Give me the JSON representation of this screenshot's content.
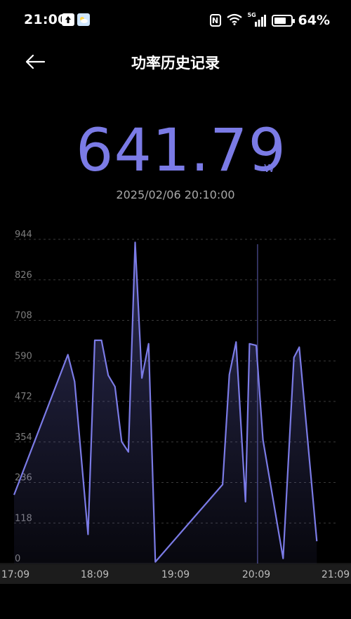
{
  "status_bar": {
    "time": "21:00",
    "battery": "64%",
    "signal_label": "5G",
    "nfc_label": "N"
  },
  "header": {
    "title": "功率历史记录",
    "back_icon": "arrow-left-icon"
  },
  "reading": {
    "value": "641.79",
    "unit": "W",
    "timestamp": "2025/02/06 20:10:00"
  },
  "colors": {
    "background": "#000000",
    "accent": "#7b7be6",
    "grid": "#3a3a3a",
    "axis_text": "#7d7d7d"
  },
  "chart_data": {
    "type": "area",
    "title": "",
    "xlabel": "",
    "ylabel": "",
    "y_ticks": [
      "944",
      "826",
      "708",
      "590",
      "472",
      "354",
      "236",
      "118",
      "0"
    ],
    "x_ticks": [
      "17:09",
      "18:09",
      "19:09",
      "20:09",
      "21:09"
    ],
    "ylim": [
      0,
      944
    ],
    "xlim_minutes": [
      0,
      240
    ],
    "x": [
      0,
      40,
      45,
      55,
      60,
      65,
      70,
      75,
      80,
      85,
      90,
      95,
      100,
      105,
      155,
      160,
      165,
      172,
      175,
      180,
      185,
      200,
      208,
      212,
      225
    ],
    "values": [
      200,
      608,
      530,
      85,
      650,
      650,
      548,
      515,
      355,
      325,
      935,
      540,
      640,
      5,
      230,
      550,
      645,
      180,
      640,
      635,
      360,
      15,
      600,
      630,
      65
    ],
    "selected_x": 181,
    "grid": true
  }
}
